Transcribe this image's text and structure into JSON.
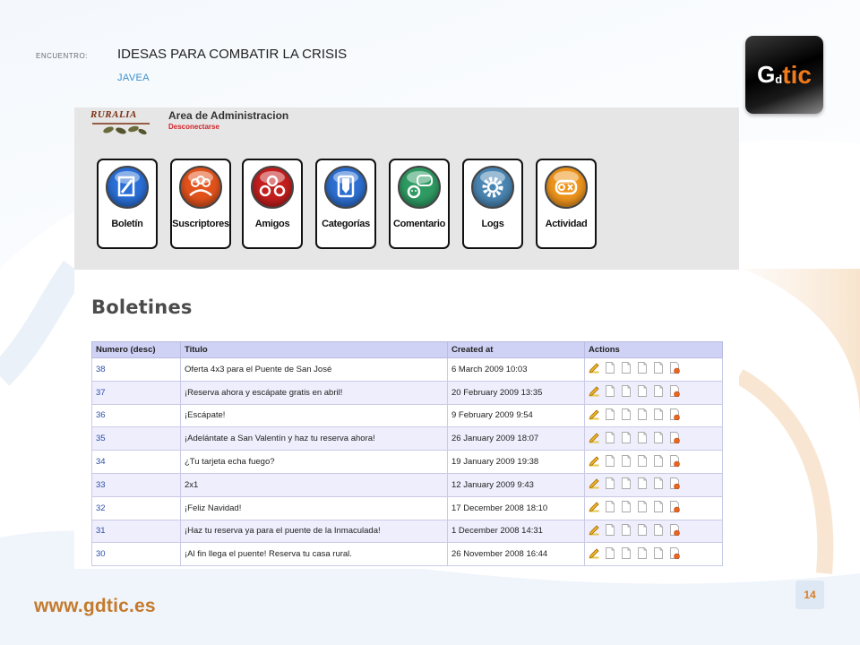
{
  "slide": {
    "label": "ENCUENTRO:",
    "title": "IDESAS PARA COMBATIR LA CRISIS",
    "subtitle": "JAVEA",
    "url": "www.gdtic.es",
    "page_number": "14",
    "logo": {
      "g": "G",
      "d": "d",
      "tic": "tic"
    }
  },
  "admin": {
    "brand": "RURALIA",
    "title": "Area de Administracion",
    "logout": "Desconectarse",
    "tiles": [
      {
        "label": "Boletín",
        "icon": "edit-icon",
        "color": "#2a6fd6"
      },
      {
        "label": "Suscriptores",
        "icon": "users-icon",
        "color": "#e2531c"
      },
      {
        "label": "Amigos",
        "icon": "friends-icon",
        "color": "#c41e1e"
      },
      {
        "label": "Categorías",
        "icon": "category-icon",
        "color": "#2d6fd0"
      },
      {
        "label": "Comentario",
        "icon": "comment-icon",
        "color": "#2f9b63"
      },
      {
        "label": "Logs",
        "icon": "gear-icon",
        "color": "#4a86b3"
      },
      {
        "label": "Actividad",
        "icon": "activity-icon",
        "color": "#ef951d"
      }
    ]
  },
  "list": {
    "heading": "Boletines",
    "columns": [
      "Numero (desc)",
      "Titulo",
      "Created at",
      "Actions"
    ],
    "rows": [
      {
        "num": "38",
        "title": "Oferta 4x3 para el Puente de San José",
        "created": "6 March 2009 10:03"
      },
      {
        "num": "37",
        "title": "¡Reserva ahora y escápate gratis en abril!",
        "created": "20 February 2009 13:35"
      },
      {
        "num": "36",
        "title": "¡Escápate!",
        "created": "9 February 2009 9:54"
      },
      {
        "num": "35",
        "title": "¡Adelántate a San Valentín y haz tu reserva ahora!",
        "created": "26 January 2009 18:07"
      },
      {
        "num": "34",
        "title": "¿Tu tarjeta echa fuego?",
        "created": "19 January 2009 19:38"
      },
      {
        "num": "33",
        "title": "2x1",
        "created": "12 January 2009 9:43"
      },
      {
        "num": "32",
        "title": "¡Feliz Navidad!",
        "created": "17 December 2008 18:10"
      },
      {
        "num": "31",
        "title": "¡Haz tu reserva ya para el puente de la Inmaculada!",
        "created": "1 December 2008 14:31"
      },
      {
        "num": "30",
        "title": "¡Al fin llega el puente! Reserva tu casa rural.",
        "created": "26 November 2008 16:44"
      }
    ],
    "action_icons": [
      "edit-icon",
      "document-icon",
      "document-icon",
      "document-icon",
      "document-icon",
      "delete-document-icon"
    ]
  }
}
